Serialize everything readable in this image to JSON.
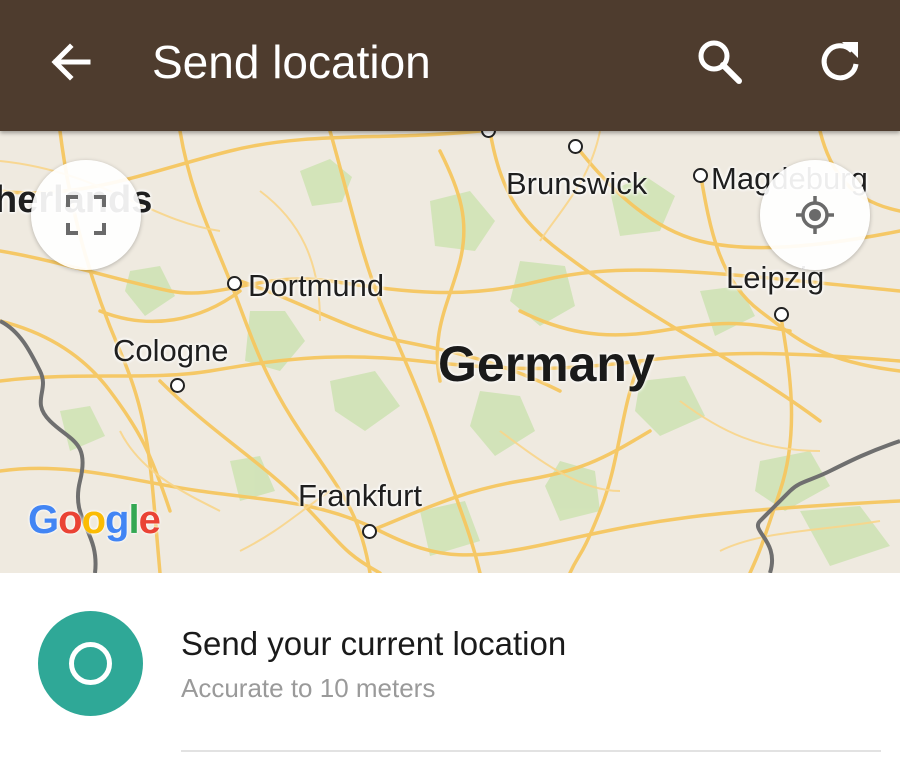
{
  "app_bar": {
    "title": "Send location",
    "icons": {
      "back": "arrow-left-icon",
      "search": "search-icon",
      "refresh": "refresh-icon"
    },
    "color": "#4e3c2e"
  },
  "map": {
    "country_label": "Germany",
    "cities": {
      "netherlands": "herlands",
      "brunswick": "Brunswick",
      "magdeburg": "Magdeburg",
      "dortmund": "Dortmund",
      "leipzig": "Leipzig",
      "cologne": "Cologne",
      "frankfurt": "Frankfurt"
    },
    "attribution": [
      "G",
      "o",
      "o",
      "g",
      "l",
      "e"
    ],
    "attribution_colors": [
      "#4285f4",
      "#ea4335",
      "#fbbc05",
      "#4285f4",
      "#34a853",
      "#ea4335"
    ],
    "icons": {
      "fullscreen": "fullscreen-icon",
      "my_location": "my-location-icon"
    },
    "colors": {
      "land": "#efeae0",
      "roads": "#f6c760",
      "forest": "#cfe3b5",
      "border": "#6f6f6f"
    }
  },
  "location_option": {
    "title": "Send your current location",
    "subtitle": "Accurate to 10 meters",
    "icon": "current-location-icon",
    "accent": "#2fa897"
  }
}
